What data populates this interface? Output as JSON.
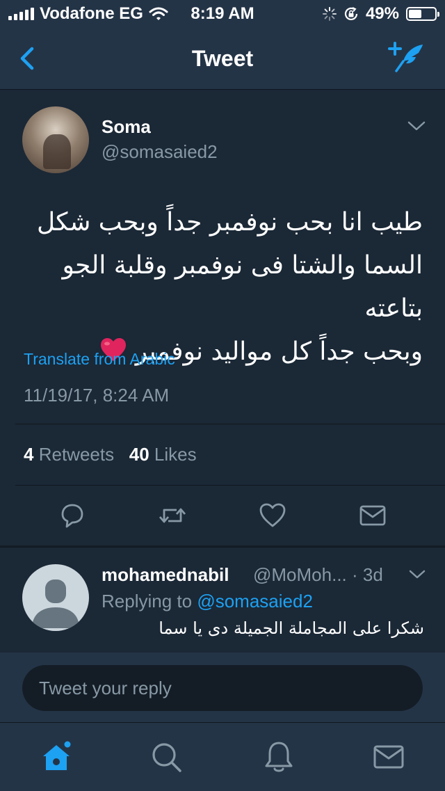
{
  "status_bar": {
    "carrier": "Vodafone EG",
    "time": "8:19 AM",
    "battery": "49%",
    "battery_level": 0.49
  },
  "nav": {
    "title": "Tweet",
    "back_icon": "chevron-left-icon",
    "compose_icon": "compose-tweet-icon"
  },
  "tweet": {
    "author_name": "Soma",
    "author_handle": "@somasaied2",
    "lines": [
      "طيب انا بحب نوفمبر جداً وبحب شكل",
      "السما والشتا فى نوفمبر وقلبة الجو بتاعته",
      "وبحب جداً كل مواليد نوفمبر"
    ],
    "emoji": "red-heart",
    "translate_label": "Translate from Arabic",
    "timestamp": "11/19/17, 8:24 AM",
    "retweets_count": "4",
    "retweets_label": "Retweets",
    "likes_count": "40",
    "likes_label": "Likes"
  },
  "reply": {
    "author_name": "mohamednabil",
    "author_handle": "@MoMoh...",
    "age": "· 3d",
    "replying_prefix": "Replying to",
    "replying_handle": "@somasaied2",
    "text": "شكرا على المجاملة الجميلة دى يا سما"
  },
  "composer": {
    "placeholder": "Tweet your reply"
  },
  "colors": {
    "background": "#141d26",
    "card": "#1b2836",
    "bars": "#243447",
    "accent": "#1da1f2",
    "secondary_text": "#8899a6",
    "heart": "#e0245e"
  }
}
